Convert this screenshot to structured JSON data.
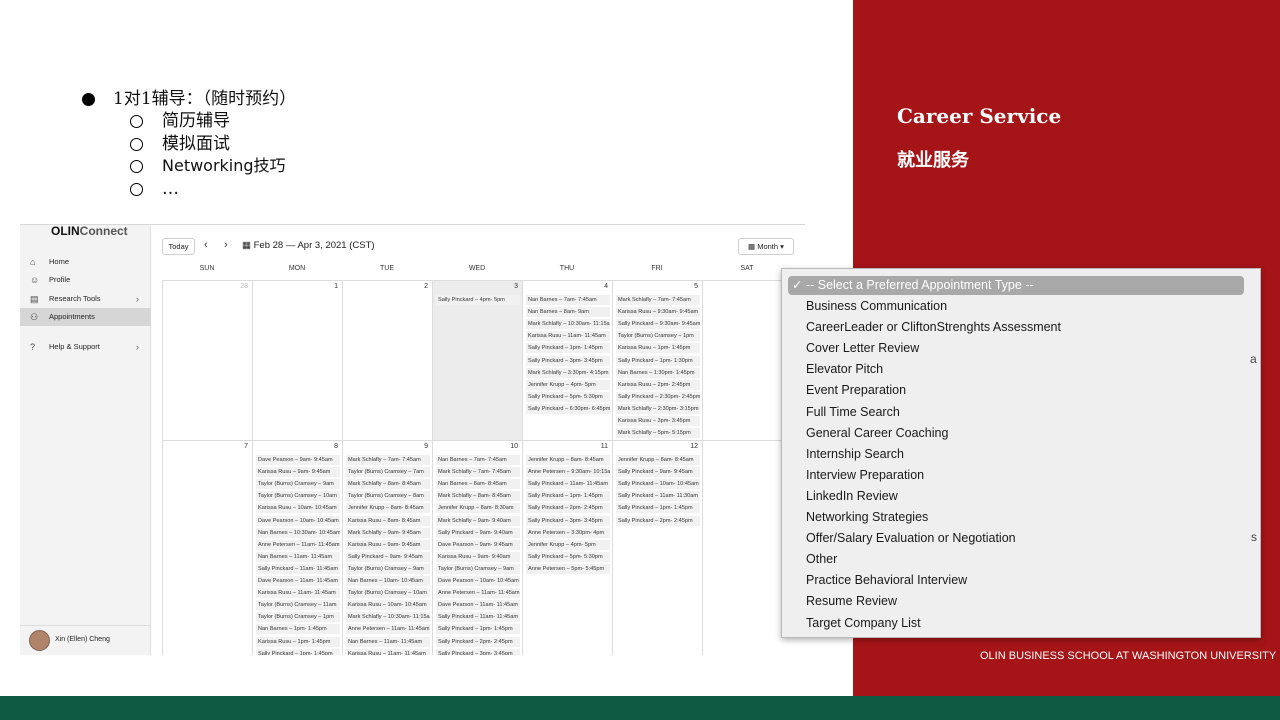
{
  "slide": {
    "bullet_main": "1对1辅导：（随时预约）",
    "bullets_sub": [
      "简历辅导",
      "模拟面试",
      "Networking技巧",
      "…"
    ],
    "panel_title": "Career Service",
    "panel_subtitle": "就业服务",
    "footer": "OLIN BUSINESS SCHOOL AT WASHINGTON UNIVERSITY",
    "colors": {
      "panel": "#a51417",
      "bottom_bar": "#0e5a42"
    }
  },
  "app": {
    "logo_bold": "OLIN",
    "logo_light": "Connect",
    "nav": [
      {
        "label": "Home",
        "icon": "home-icon"
      },
      {
        "label": "Profile",
        "icon": "person-icon"
      },
      {
        "label": "Research Tools",
        "icon": "research-icon"
      },
      {
        "label": "Appointments",
        "icon": "people-icon"
      },
      {
        "label": "Help & Support",
        "icon": "help-icon"
      }
    ],
    "user_name": "Xin (Ellen) Cheng",
    "toolbar": {
      "today": "Today",
      "range": "Feb 28 — Apr 3, 2021 (CST)",
      "view": "Month"
    },
    "days": [
      "SUN",
      "MON",
      "TUE",
      "WED",
      "THU",
      "FRI",
      "SAT"
    ],
    "week1": {
      "dates": [
        "28",
        "1",
        "2",
        "3",
        "4",
        "5",
        ""
      ],
      "wed": [
        "Sally Pinckard – 4pm- 5pm"
      ],
      "thu": [
        "Nan Barnes – 7am- 7:45am",
        "Nan Barnes – 8am- 9am",
        "Mark Schlafly – 10:30am- 11:15am",
        "Karissa Rusu – 11am- 11:45am",
        "Sally Pinckard – 1pm- 1:45pm",
        "Sally Pinckard – 3pm- 3:45pm",
        "Mark Schlafly – 3:30pm- 4:15pm",
        "Jennifer Krupp – 4pm- 5pm",
        "Sally Pinckard – 5pm- 5:30pm",
        "Sally Pinckard – 6:30pm- 6:45pm"
      ],
      "fri": [
        "Mark Schlafly – 7am- 7:45am",
        "Karissa Rusu – 9:30am- 9:45am",
        "Sally Pinckard – 9:30am- 9:45am",
        "Taylor (Burns) Cramsey – 1pm",
        "Karissa Rusu – 1pm- 1:45pm",
        "Sally Pinckard – 1pm- 1:30pm",
        "Nan Barnes – 1:30pm- 1:45pm",
        "Karissa Rusu – 2pm- 2:45pm",
        "Sally Pinckard – 2:30pm- 2:45pm",
        "Mark Schlafly – 2:30pm- 3:15pm",
        "Karissa Rusu – 3pm- 3:45pm",
        "Mark Schlafly – 5pm- 5:15pm"
      ]
    },
    "week2": {
      "dates": [
        "7",
        "8",
        "9",
        "10",
        "11",
        "12",
        ""
      ],
      "mon": [
        "Dave Pearson – 9am- 9:45am",
        "Karissa Rusu – 9am- 9:45am",
        "Taylor (Burns) Cramsey – 9am",
        "Taylor (Burns) Cramsey – 10am",
        "Karissa Rusu – 10am- 10:45am",
        "Dave Pearson – 10am- 10:45am",
        "Nan Barnes – 10:30am- 10:45am",
        "Anne Petersen – 11am- 11:45am",
        "Nan Barnes – 11am- 11:45am",
        "Sally Pinckard – 11am- 11:45am",
        "Dave Pearson – 11am- 11:45am",
        "Karissa Rusu – 11am- 11:45am",
        "Taylor (Burns) Cramsey – 11am",
        "Taylor (Burns) Cramsey – 1pm",
        "Nan Barnes – 1pm- 1:45pm",
        "Karissa Rusu – 1pm- 1:45pm",
        "Sally Pinckard – 1pm- 1:45pm"
      ],
      "tue": [
        "Mark Schlafly – 7am- 7:45am",
        "Taylor (Burns) Cramsey – 7am",
        "Mark Schlafly – 8am- 8:45am",
        "Taylor (Burns) Cramsey – 8am",
        "Jennifer Krupp – 8am- 8:45am",
        "Karissa Rusu – 8am- 8:45am",
        "Mark Schlafly – 9am- 9:45am",
        "Karissa Rusu – 9am- 9:45am",
        "Sally Pinckard – 9am- 9:45am",
        "Taylor (Burns) Cramsey – 9am",
        "Nan Barnes – 10am- 10:45am",
        "Taylor (Burns) Cramsey – 10am",
        "Karissa Rusu – 10am- 10:45am",
        "Mark Schlafly – 10:30am- 11:15am",
        "Anne Petersen – 11am- 11:45am",
        "Nan Barnes – 11am- 11:45am",
        "Karissa Rusu – 11am- 11:45am"
      ],
      "wed": [
        "Nan Barnes – 7am- 7:45am",
        "Mark Schlafly – 7am- 7:45am",
        "Nan Barnes – 8am- 8:45am",
        "Mark Schlafly – 8am- 8:45am",
        "Jennifer Krupp – 8am- 8:30am",
        "Mark Schlafly – 9am- 9:40am",
        "Sally Pinckard – 9am- 9:40am",
        "Dave Pearson – 9am- 9:45am",
        "Karissa Rusu – 9am- 9:40am",
        "Taylor (Burns) Cramsey – 9am",
        "Dave Pearson – 10am- 10:45am",
        "Anne Petersen – 11am- 11:45am",
        "Dave Pearson – 11am- 11:45am",
        "Sally Pinckard – 11am- 11:45am",
        "Sally Pinckard – 1pm- 1:45pm",
        "Sally Pinckard – 2pm- 2:45pm",
        "Sally Pinckard – 3pm- 3:45pm"
      ],
      "thu": [
        "Jennifer Krupp – 8am- 8:45am",
        "Anne Petersen – 9:30am- 10:15am",
        "Sally Pinckard – 11am- 11:45am",
        "Sally Pinckard – 1pm- 1:45pm",
        "Sally Pinckard – 2pm- 2:45pm",
        "Sally Pinckard – 3pm- 3:45pm",
        "Anne Petersen – 3:30pm- 4pm",
        "Jennifer Krupp – 4pm- 5pm",
        "Sally Pinckard – 5pm- 5:30pm",
        "Anne Petersen – 5pm- 5:45pm"
      ],
      "fri": [
        "Jennifer Krupp – 8am- 8:45am",
        "Sally Pinckard – 9am- 9:45am",
        "Sally Pinckard – 10am- 10:45am",
        "Sally Pinckard – 11am- 11:30am",
        "Sally Pinckard – 1pm- 1:45pm",
        "Sally Pinckard – 2pm- 2:45pm"
      ]
    }
  },
  "dropdown": {
    "selected": "✓ -- Select a Preferred Appointment Type --",
    "options": [
      "Business Communication",
      "CareerLeader or CliftonStrenghts Assessment",
      "Cover Letter Review",
      "Elevator Pitch",
      "Event Preparation",
      "Full Time Search",
      "General Career Coaching",
      "Internship Search",
      "Interview Preparation",
      "LinkedIn Review",
      "Networking Strategies",
      "Offer/Salary Evaluation or Negotiation",
      "Other",
      "Practice Behavioral Interview",
      "Resume Review",
      "Target Company List"
    ]
  }
}
